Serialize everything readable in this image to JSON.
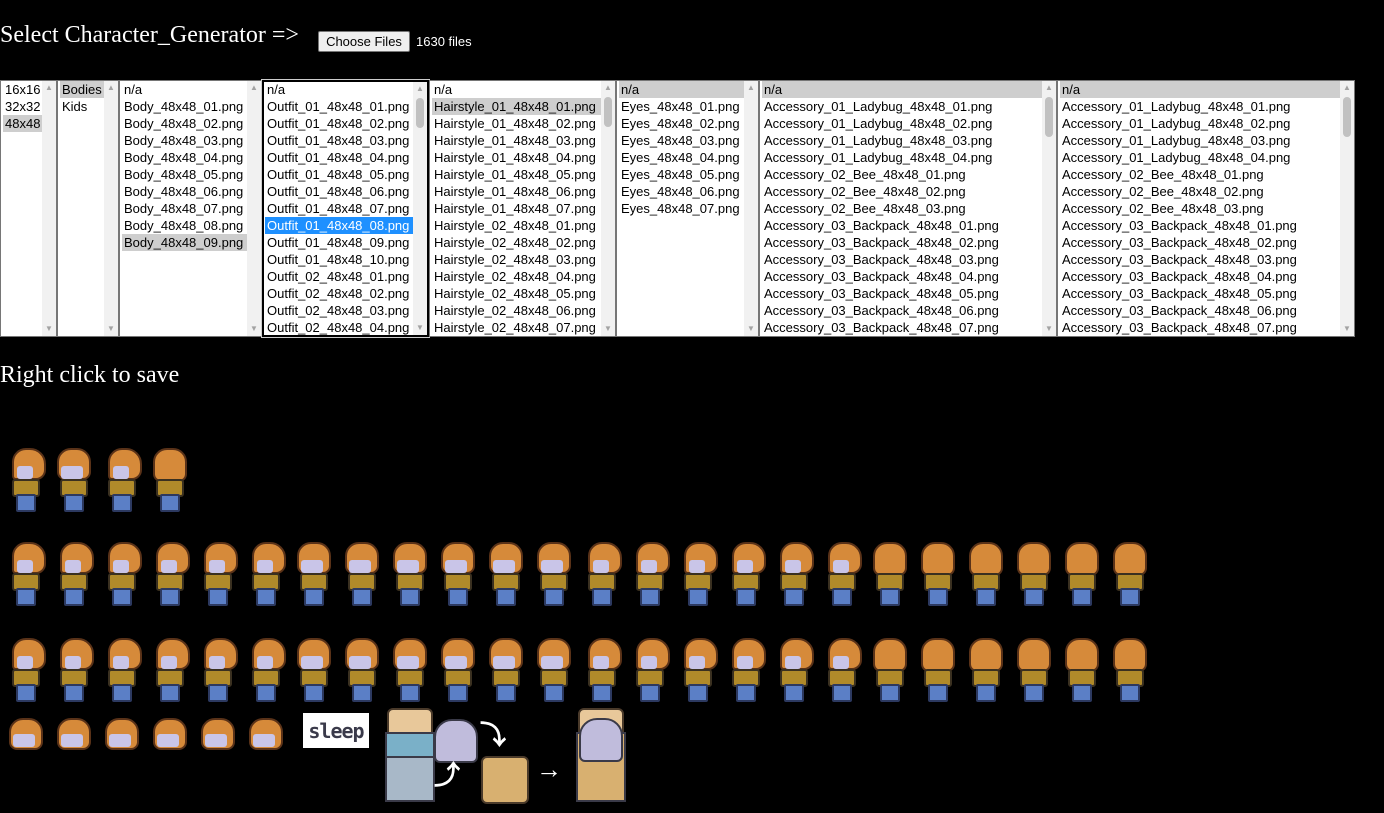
{
  "header": {
    "title": "Select Character_Generator =>",
    "choose_button": "Choose Files",
    "file_count": "1630 files"
  },
  "lists": {
    "size": {
      "options": [
        "16x16",
        "32x32",
        "48x48"
      ],
      "selected": "48x48"
    },
    "category": {
      "options": [
        "Bodies",
        "Kids"
      ],
      "selected": "Bodies"
    },
    "body": {
      "options": [
        "n/a",
        "Body_48x48_01.png",
        "Body_48x48_02.png",
        "Body_48x48_03.png",
        "Body_48x48_04.png",
        "Body_48x48_05.png",
        "Body_48x48_06.png",
        "Body_48x48_07.png",
        "Body_48x48_08.png",
        "Body_48x48_09.png"
      ],
      "selected": "Body_48x48_09.png"
    },
    "outfit": {
      "options": [
        "n/a",
        "Outfit_01_48x48_01.png",
        "Outfit_01_48x48_02.png",
        "Outfit_01_48x48_03.png",
        "Outfit_01_48x48_04.png",
        "Outfit_01_48x48_05.png",
        "Outfit_01_48x48_06.png",
        "Outfit_01_48x48_07.png",
        "Outfit_01_48x48_08.png",
        "Outfit_01_48x48_09.png",
        "Outfit_01_48x48_10.png",
        "Outfit_02_48x48_01.png",
        "Outfit_02_48x48_02.png",
        "Outfit_02_48x48_03.png",
        "Outfit_02_48x48_04.png"
      ],
      "selected": "Outfit_01_48x48_08.png"
    },
    "hairstyle": {
      "options": [
        "n/a",
        "Hairstyle_01_48x48_01.png",
        "Hairstyle_01_48x48_02.png",
        "Hairstyle_01_48x48_03.png",
        "Hairstyle_01_48x48_04.png",
        "Hairstyle_01_48x48_05.png",
        "Hairstyle_01_48x48_06.png",
        "Hairstyle_01_48x48_07.png",
        "Hairstyle_02_48x48_01.png",
        "Hairstyle_02_48x48_02.png",
        "Hairstyle_02_48x48_03.png",
        "Hairstyle_02_48x48_04.png",
        "Hairstyle_02_48x48_05.png",
        "Hairstyle_02_48x48_06.png",
        "Hairstyle_02_48x48_07.png"
      ],
      "selected": "Hairstyle_01_48x48_01.png"
    },
    "eyes": {
      "options": [
        "n/a",
        "Eyes_48x48_01.png",
        "Eyes_48x48_02.png",
        "Eyes_48x48_03.png",
        "Eyes_48x48_04.png",
        "Eyes_48x48_05.png",
        "Eyes_48x48_06.png",
        "Eyes_48x48_07.png"
      ],
      "selected": "n/a"
    },
    "accessory1": {
      "options": [
        "n/a",
        "Accessory_01_Ladybug_48x48_01.png",
        "Accessory_01_Ladybug_48x48_02.png",
        "Accessory_01_Ladybug_48x48_03.png",
        "Accessory_01_Ladybug_48x48_04.png",
        "Accessory_02_Bee_48x48_01.png",
        "Accessory_02_Bee_48x48_02.png",
        "Accessory_02_Bee_48x48_03.png",
        "Accessory_03_Backpack_48x48_01.png",
        "Accessory_03_Backpack_48x48_02.png",
        "Accessory_03_Backpack_48x48_03.png",
        "Accessory_03_Backpack_48x48_04.png",
        "Accessory_03_Backpack_48x48_05.png",
        "Accessory_03_Backpack_48x48_06.png",
        "Accessory_03_Backpack_48x48_07.png"
      ],
      "selected": "n/a"
    },
    "accessory2": {
      "options": [
        "n/a",
        "Accessory_01_Ladybug_48x48_01.png",
        "Accessory_01_Ladybug_48x48_02.png",
        "Accessory_01_Ladybug_48x48_03.png",
        "Accessory_01_Ladybug_48x48_04.png",
        "Accessory_02_Bee_48x48_01.png",
        "Accessory_02_Bee_48x48_02.png",
        "Accessory_02_Bee_48x48_03.png",
        "Accessory_03_Backpack_48x48_01.png",
        "Accessory_03_Backpack_48x48_02.png",
        "Accessory_03_Backpack_48x48_03.png",
        "Accessory_03_Backpack_48x48_04.png",
        "Accessory_03_Backpack_48x48_05.png",
        "Accessory_03_Backpack_48x48_06.png",
        "Accessory_03_Backpack_48x48_07.png"
      ],
      "selected": "n/a"
    }
  },
  "preview": {
    "title": "Right click to save",
    "sleep_label": "sleep",
    "rows": [
      {
        "name": "idle-row",
        "poses": [
          "side",
          "front",
          "side",
          "back"
        ]
      },
      {
        "name": "walk-row",
        "poses": [
          "side",
          "side",
          "side",
          "side",
          "side",
          "side",
          "front",
          "front",
          "front",
          "front",
          "front",
          "front",
          "side",
          "side",
          "side",
          "side",
          "side",
          "side",
          "back",
          "back",
          "back",
          "back",
          "back",
          "back"
        ]
      },
      {
        "name": "run-row",
        "poses": [
          "side",
          "side",
          "side",
          "side",
          "side",
          "side",
          "front",
          "front",
          "front",
          "front",
          "front",
          "front",
          "side",
          "side",
          "side",
          "side",
          "side",
          "side",
          "back",
          "back",
          "back",
          "back",
          "back",
          "back"
        ]
      },
      {
        "name": "sit-row",
        "poses": [
          "small",
          "small",
          "small",
          "small",
          "small",
          "small"
        ]
      }
    ]
  },
  "colors": {
    "background": "#000000",
    "selected_focus": "#1e90ff",
    "selected_inactive": "#cecece"
  }
}
